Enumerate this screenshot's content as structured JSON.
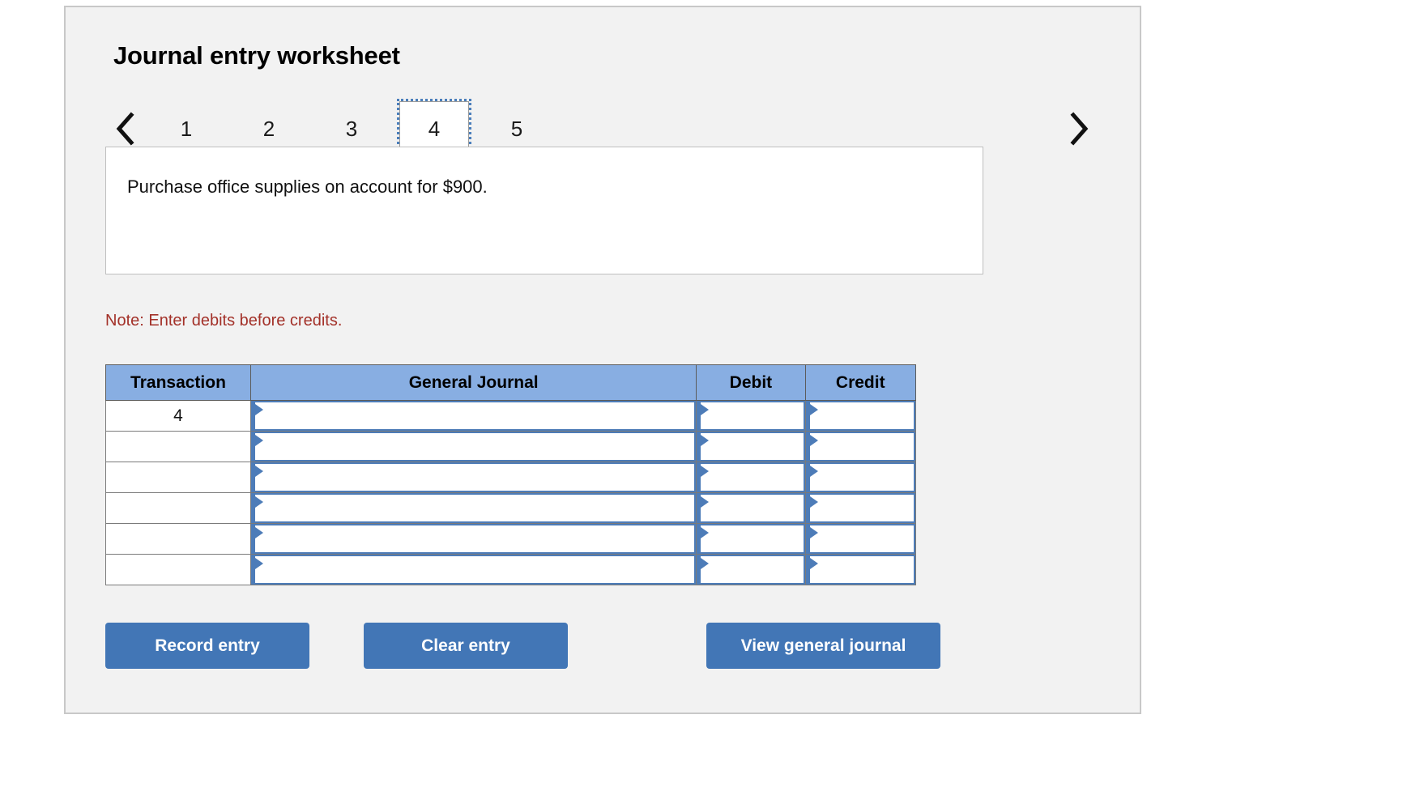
{
  "panel": {
    "title": "Journal entry worksheet"
  },
  "pager": {
    "prev_icon": "chevron-left-icon",
    "next_icon": "chevron-right-icon",
    "pages": [
      {
        "label": "1",
        "selected": false
      },
      {
        "label": "2",
        "selected": false
      },
      {
        "label": "3",
        "selected": false
      },
      {
        "label": "4",
        "selected": true
      },
      {
        "label": "5",
        "selected": false
      }
    ],
    "selected_page": "4"
  },
  "description": {
    "text": "Purchase office supplies on account for $900."
  },
  "note": {
    "text": "Note: Enter debits before credits."
  },
  "table": {
    "headers": {
      "transaction": "Transaction",
      "general_journal": "General Journal",
      "debit": "Debit",
      "credit": "Credit"
    },
    "rows": [
      {
        "transaction": "4",
        "general_journal": "",
        "debit": "",
        "credit": ""
      },
      {
        "transaction": "",
        "general_journal": "",
        "debit": "",
        "credit": ""
      },
      {
        "transaction": "",
        "general_journal": "",
        "debit": "",
        "credit": ""
      },
      {
        "transaction": "",
        "general_journal": "",
        "debit": "",
        "credit": ""
      },
      {
        "transaction": "",
        "general_journal": "",
        "debit": "",
        "credit": ""
      },
      {
        "transaction": "",
        "general_journal": "",
        "debit": "",
        "credit": ""
      }
    ]
  },
  "buttons": {
    "record_entry": "Record entry",
    "clear_entry": "Clear entry",
    "view_general_journal": "View general journal"
  },
  "colors": {
    "panel_background": "#f2f2f2",
    "table_header_blue": "#88aee2",
    "button_blue": "#4276b6",
    "input_border_blue": "#4d7cb8",
    "note_red": "#a33129",
    "focus_outline_blue": "#4a7ebb"
  }
}
